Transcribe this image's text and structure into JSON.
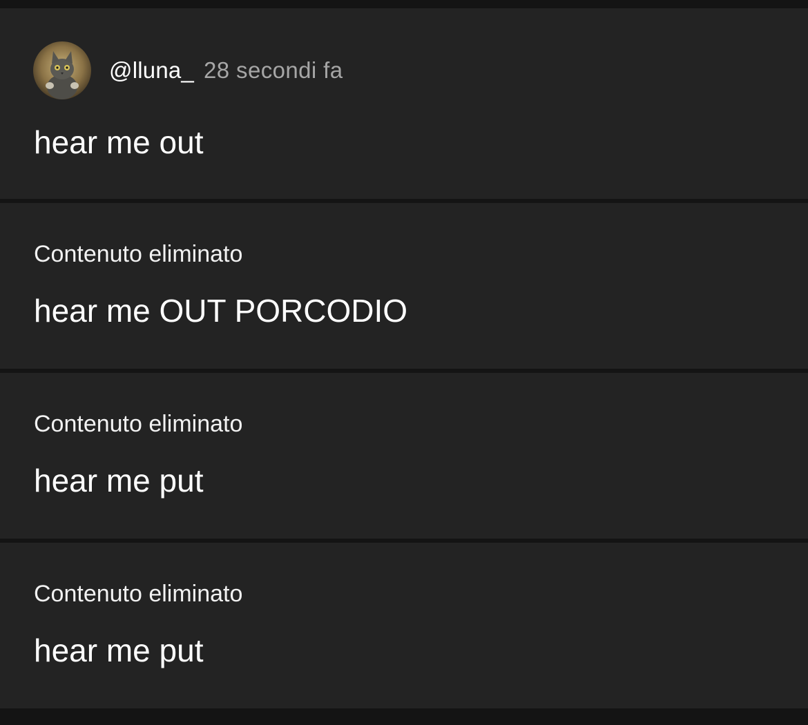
{
  "posts": [
    {
      "author": {
        "username": "@lluna_",
        "time": "28 secondi fa",
        "avatar_icon": "cat-avatar"
      },
      "text": "hear me out"
    },
    {
      "deleted_label": "Contenuto eliminato",
      "text": "hear me OUT PORCODIO"
    },
    {
      "deleted_label": "Contenuto eliminato",
      "text": "hear me put"
    },
    {
      "deleted_label": "Contenuto eliminato",
      "text": "hear me put"
    }
  ],
  "colors": {
    "background": "#141414",
    "card": "#232323",
    "text": "#ffffff",
    "muted": "#a6a6a6"
  }
}
